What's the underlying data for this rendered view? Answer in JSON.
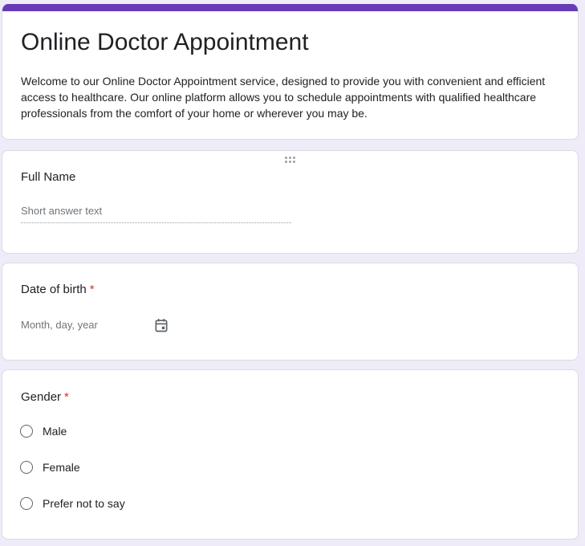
{
  "form": {
    "title": "Online Doctor Appointment",
    "description": "Welcome to our Online Doctor Appointment service, designed to provide you with convenient and efficient access to healthcare. Our online platform allows you to schedule appointments with qualified healthcare professionals from the comfort of your home or wherever you may be.",
    "accent_color": "#673ab7",
    "background_color": "#efebf8"
  },
  "questions": {
    "full_name": {
      "label": "Full Name",
      "placeholder": "Short answer text"
    },
    "dob": {
      "label": "Date of birth",
      "required_mark": "*",
      "placeholder": "Month, day, year",
      "icon": "calendar-icon"
    },
    "gender": {
      "label": "Gender",
      "required_mark": "*",
      "options": [
        "Male",
        "Female",
        "Prefer not to say"
      ]
    }
  },
  "colors": {
    "required": "#d93025"
  }
}
